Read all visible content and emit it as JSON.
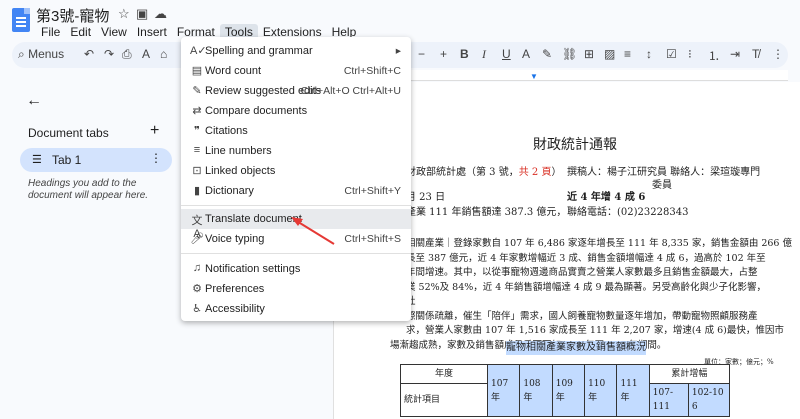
{
  "titlebar": {
    "title": "第3號-寵物"
  },
  "menubar": {
    "items": [
      "File",
      "Edit",
      "View",
      "Insert",
      "Format",
      "Tools",
      "Extensions",
      "Help"
    ]
  },
  "toolbar": {
    "search_label": "Menus"
  },
  "sidebar": {
    "heading": "Document tabs",
    "tab_label": "Tab 1",
    "hint": "Headings you add to the document will appear here."
  },
  "doc": {
    "heading": "財政統計通報",
    "line1_a": "財政部統計處（第 3 號，",
    "line1_b": "共 2 頁",
    "line1_c": "）",
    "line1_right": "撰稿人：楊子江研究員 聯絡人：梁瑄璇專門",
    "line1_right2": "委員",
    "line2_left": "月 23 日",
    "line2_right": "近 4 年增 4 成 6",
    "line3_left": "產業 111 年銷售額達 387.3 億元，",
    "line3_right": "聯絡電話：(02)23228343",
    "para1": [
      "相關產業｜登錄家數自 107 年 6,486 家逐年增長至 111 年 8,335 家，銷售金額由 266 億",
      "長至 387 億元，近 4 年家數增幅近 3 成、銷售金額增幅達 4 成 6，過高於 102 年至",
      "年間增速。其中，以從事寵物週邊商品實賣之營業人家數最多且銷售金額最大，占整",
      "業 52%及 84%，近 4 年銷售額增幅達 4 成 9 最為顯著。另受高齡化與少子化影響，",
      "社",
      "際關係疏離，催生「陪伴」需求，國人飼養寵物數量逐年增加，帶動寵物照顧服務產",
      "求，營業人家數由 107 年 1,516 家成長至 111 年 2,207 家，增速(4 成 6)最快，惟因市",
      "場漸趨成熟，家數及銷售額成長反而不如 102 年至 106 年期間。"
    ],
    "table_title": "寵物相關產業家數及銷售額概況",
    "table_unit": "單位：家數；億元；%",
    "table_headers": [
      "年度",
      "107 年",
      "108 年",
      "109 年",
      "110 年",
      "111 年",
      "累計增幅"
    ],
    "table_row_label": "統計項目",
    "table_sub": [
      "107-111",
      "102-10 6"
    ]
  },
  "tools_menu": {
    "items": [
      {
        "icon": "spellcheck-icon",
        "label": "Spelling and grammar",
        "shortcut": "▸"
      },
      {
        "icon": "word-count-icon",
        "label": "Word count",
        "shortcut": "Ctrl+Shift+C"
      },
      {
        "icon": "review-edits-icon",
        "label": "Review suggested edits",
        "shortcut": "Ctrl+Alt+O Ctrl+Alt+U"
      },
      {
        "icon": "compare-icon",
        "label": "Compare documents",
        "shortcut": ""
      },
      {
        "icon": "citations-icon",
        "label": "Citations",
        "shortcut": ""
      },
      {
        "icon": "line-numbers-icon",
        "label": "Line numbers",
        "shortcut": ""
      },
      {
        "icon": "linked-objects-icon",
        "label": "Linked objects",
        "shortcut": ""
      },
      {
        "icon": "dictionary-icon",
        "label": "Dictionary",
        "shortcut": "Ctrl+Shift+Y"
      },
      {
        "icon": "translate-icon",
        "label": "Translate document",
        "shortcut": ""
      },
      {
        "icon": "microphone-icon",
        "label": "Voice typing",
        "shortcut": "Ctrl+Shift+S"
      },
      {
        "icon": "bell-icon",
        "label": "Notification settings",
        "shortcut": ""
      },
      {
        "icon": "preferences-icon",
        "label": "Preferences",
        "shortcut": ""
      },
      {
        "icon": "accessibility-icon",
        "label": "Accessibility",
        "shortcut": ""
      }
    ]
  },
  "colors": {
    "accent": "#1a73e8",
    "tab_active": "#d3e3fd",
    "annotation_arrow": "#e53935"
  }
}
